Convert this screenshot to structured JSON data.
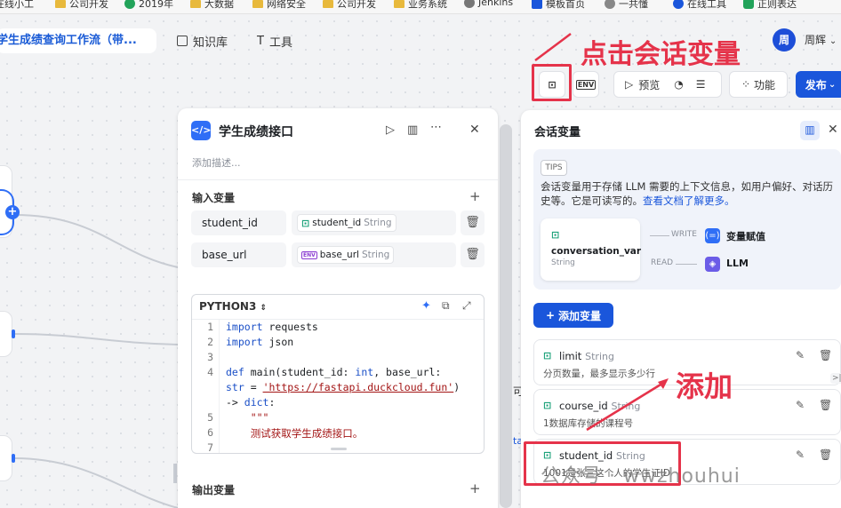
{
  "bookmarks": [
    {
      "label": "在线小工",
      "kind": "plain"
    },
    {
      "label": "公司开发",
      "kind": "folder"
    },
    {
      "label": "2019年",
      "kind": "logo",
      "color": "#22a35a"
    },
    {
      "label": "大数据",
      "kind": "folder"
    },
    {
      "label": "网络安全",
      "kind": "folder"
    },
    {
      "label": "公司开发",
      "kind": "folder"
    },
    {
      "label": "业务系统",
      "kind": "folder"
    },
    {
      "label": "Jenkins",
      "kind": "logo",
      "color": "#777777"
    },
    {
      "label": "模板首页",
      "kind": "logo",
      "color": "#1a56db"
    },
    {
      "label": "一共懂",
      "kind": "logo",
      "color": "#888888"
    },
    {
      "label": "在线工具",
      "kind": "logo",
      "color": "#1a56db"
    },
    {
      "label": "正则表达",
      "kind": "logo",
      "color": "#22a35a"
    }
  ],
  "header": {
    "workflow_tab": "学生成绩查询工作流（带...",
    "knowledge_label": "知识库",
    "tools_label": "工具",
    "avatar_text": "周",
    "user_name": "周辉"
  },
  "annotations": {
    "click_conv_var": "点击会话变量",
    "add": "添加",
    "watermark": "公众号 · wwzhouhui"
  },
  "toolbar": {
    "conv_var_icon": "conversation-variable-icon",
    "env_label": "ENV",
    "preview_label": "预览",
    "features_label": "功能",
    "publish_label": "发布"
  },
  "node": {
    "icon_text": "</>",
    "title": "学生成绩接口",
    "description_placeholder": "添加描述...",
    "input_section": "输入变量",
    "inputs": [
      {
        "name": "student_id",
        "ref": "student_id",
        "type": "String",
        "scope": "conversation"
      },
      {
        "name": "base_url",
        "ref": "base_url",
        "type": "String",
        "scope": "env"
      }
    ],
    "code": {
      "language": "PYTHON3",
      "lines": [
        {
          "no": "1",
          "text": "import requests"
        },
        {
          "no": "2",
          "text": "import json"
        },
        {
          "no": "3",
          "text": ""
        },
        {
          "no": "4",
          "text": "def main(student_id: int, base_url:"
        },
        {
          "no": "",
          "text": "str = 'https://fastapi.duckcloud.fun')"
        },
        {
          "no": "",
          "text": "-> dict:"
        },
        {
          "no": "5",
          "text": "    \"\"\""
        },
        {
          "no": "6",
          "text": "    测试获取学生成绩接口。"
        },
        {
          "no": "7",
          "text": ""
        }
      ]
    },
    "output_section": "输出变量"
  },
  "panel": {
    "title": "会话变量",
    "tips_badge": "TIPS",
    "tips_text": "会话变量用于存储 LLM 需要的上下文信息，如用户偏好、对话历史等。它是可读写的。",
    "tips_link": "查看文档了解更多。",
    "diagram": {
      "var_name": "conversation_var",
      "var_type": "String",
      "write_label": "WRITE",
      "read_label": "READ",
      "assign_label": "变量赋值",
      "llm_label": "LLM"
    },
    "add_button": "添加变量",
    "variables": [
      {
        "name": "limit",
        "type": "String",
        "desc": "分页数量，最多显示多少行"
      },
      {
        "name": "course_id",
        "type": "String",
        "desc": "1数据库存储的课程号"
      },
      {
        "name": "student_id",
        "type": "String",
        "desc": "1001是张三这个人的学生证ID"
      }
    ]
  },
  "colors": {
    "accent": "#1a56db",
    "annotation": "#e5334a",
    "var_icon": "#1aa179"
  }
}
